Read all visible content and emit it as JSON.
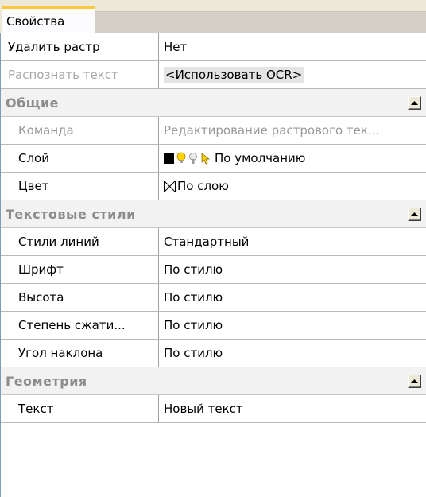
{
  "tabs": [
    {
      "label": "Свойства"
    }
  ],
  "top_rows": [
    {
      "name": "Удалить растр",
      "value": "Нет",
      "disabled": false
    },
    {
      "name": "Распознать текст",
      "value": "<Использовать OCR>",
      "disabled": true
    }
  ],
  "categories": [
    {
      "title": "Общие",
      "rows": [
        {
          "name": "Команда",
          "value": "Редактирование растрового тек...",
          "disabled": true
        },
        {
          "name": "Слой",
          "value": "По умолчанию",
          "disabled": false,
          "icons": [
            "color-swatch-icon",
            "lightbulb-icon",
            "freeze-icon",
            "lock-icon"
          ]
        },
        {
          "name": "Цвет",
          "value": "По слою",
          "disabled": false,
          "icons": [
            "color-box-icon"
          ]
        }
      ]
    },
    {
      "title": "Текстовые стили",
      "rows": [
        {
          "name": "Стили линий",
          "value": "Стандартный",
          "disabled": false
        },
        {
          "name": "Шрифт",
          "value": "По стилю",
          "disabled": false
        },
        {
          "name": "Высота",
          "value": "По стилю",
          "disabled": false
        },
        {
          "name": "Степень сжати...",
          "value": "По стилю",
          "disabled": false
        },
        {
          "name": "Угол наклона",
          "value": "По стилю",
          "disabled": false
        }
      ]
    },
    {
      "title": "Геометрия",
      "rows": [
        {
          "name": "Текст",
          "value": "Новый текст",
          "disabled": false
        }
      ]
    }
  ],
  "colors": {
    "tab_accent": "#ffc83c",
    "category_bg": "#f2f2f2",
    "category_text": "#8c8c8c",
    "disabled_text": "#999999",
    "layer_swatch": "#000000",
    "bulb": "#ffd400"
  }
}
